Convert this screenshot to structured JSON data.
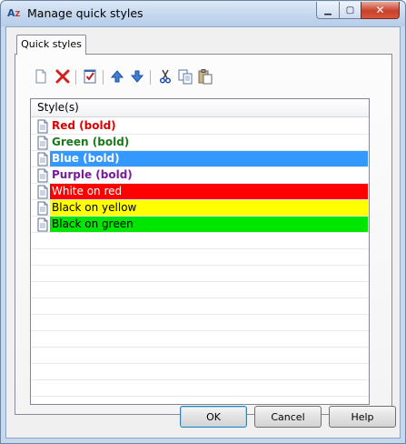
{
  "window": {
    "title": "Manage quick styles"
  },
  "titlebar_buttons": {
    "minimize": "▁",
    "maximize": "▢",
    "close": "✕"
  },
  "tabs": [
    {
      "label": "Quick styles"
    }
  ],
  "toolbar": {
    "buttons": [
      "new-icon",
      "delete-icon",
      "edit-icon",
      "move-up-icon",
      "move-down-icon",
      "cut-icon",
      "copy-icon",
      "paste-icon"
    ]
  },
  "list": {
    "header": "Style(s)",
    "items": [
      {
        "label": "Red (bold)",
        "fg": "#e00000",
        "bg": "#ffffff",
        "bold": true
      },
      {
        "label": "Green (bold)",
        "fg": "#1a7a1a",
        "bg": "#ffffff",
        "bold": true
      },
      {
        "label": "Blue (bold)",
        "fg": "#ffffff",
        "bg": "#3399ff",
        "bold": true,
        "selected": true
      },
      {
        "label": "Purple (bold)",
        "fg": "#7a1a9a",
        "bg": "#ffffff",
        "bold": true
      },
      {
        "label": "White on red",
        "fg": "#ffffff",
        "bg": "#ff0000",
        "bold": false
      },
      {
        "label": "Black on yellow",
        "fg": "#000000",
        "bg": "#ffff00",
        "bold": false
      },
      {
        "label": "Black on green",
        "fg": "#000000",
        "bg": "#00e600",
        "bold": false
      }
    ]
  },
  "buttons": {
    "ok": "OK",
    "cancel": "Cancel",
    "help": "Help"
  }
}
